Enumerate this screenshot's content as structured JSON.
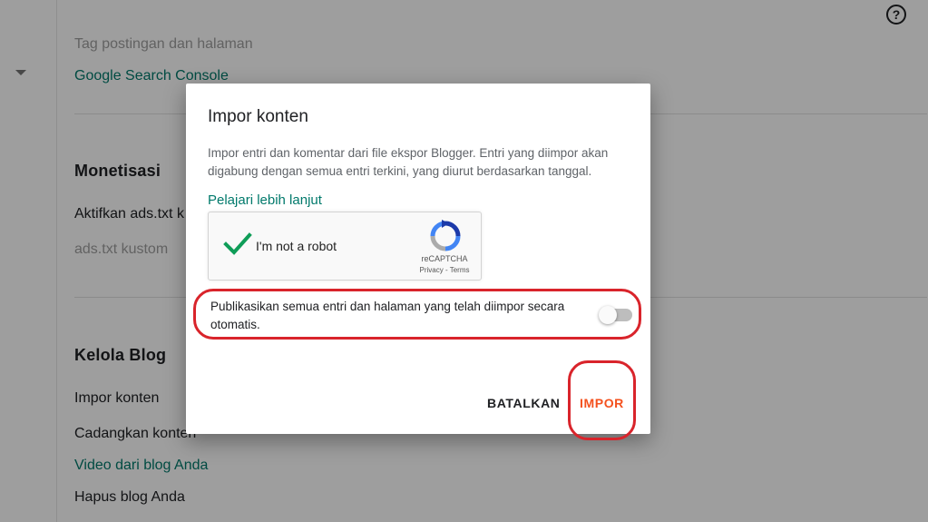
{
  "background": {
    "partial_top_text": "Tag postingan dan halaman",
    "search_console_link": "Google Search Console",
    "monetization": {
      "title": "Monetisasi",
      "ads_txt_label": "Aktifkan ads.txt k",
      "ads_txt_custom": "ads.txt kustom"
    },
    "manage_blog": {
      "title": "Kelola Blog",
      "items": [
        "Impor konten",
        "Cadangkan konten",
        "Video dari blog Anda",
        "Hapus blog Anda"
      ]
    },
    "help_icon_glyph": "?"
  },
  "dialog": {
    "title": "Impor konten",
    "description": "Impor entri dan komentar dari file ekspor Blogger. Entri yang diimpor akan digabung dengan semua entri terkini, yang diurut berdasarkan tanggal.",
    "learn_more": "Pelajari lebih lanjut",
    "recaptcha": {
      "label": "I'm not a robot",
      "brand": "reCAPTCHA",
      "terms": "Privacy - Terms",
      "checked": true
    },
    "auto_publish": {
      "label": "Publikasikan semua entri dan halaman yang telah diimpor secara otomatis.",
      "enabled": false
    },
    "buttons": {
      "cancel": "BATALKAN",
      "import": "IMPOR"
    }
  },
  "colors": {
    "link": "#00796b",
    "import_accent": "#f4511e",
    "highlight": "#d9242b"
  }
}
